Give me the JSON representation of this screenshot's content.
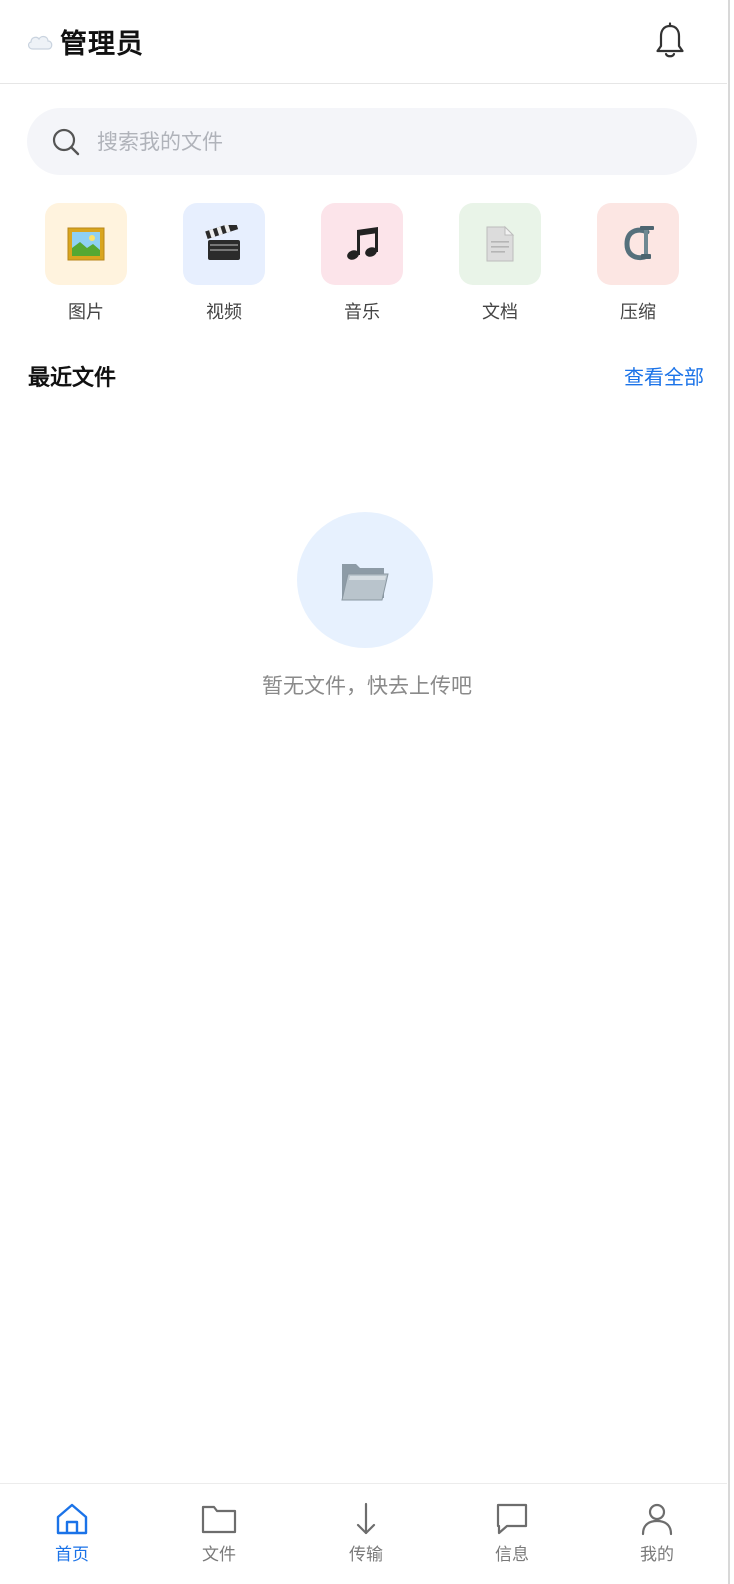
{
  "header": {
    "title": "管理员",
    "cloud_icon": "cloud-icon",
    "bell_icon": "bell-icon"
  },
  "search": {
    "placeholder": "搜索我的文件",
    "value": ""
  },
  "categories": [
    {
      "label": "图片",
      "icon": "picture-icon",
      "tile_color": "#fff3de"
    },
    {
      "label": "视频",
      "icon": "clapper-icon",
      "tile_color": "#e7effe"
    },
    {
      "label": "音乐",
      "icon": "music-note-icon",
      "tile_color": "#fce4ea"
    },
    {
      "label": "文档",
      "icon": "document-icon",
      "tile_color": "#e9f4e8"
    },
    {
      "label": "压缩",
      "icon": "clamp-icon",
      "tile_color": "#fce6e3"
    }
  ],
  "recent": {
    "title": "最近文件",
    "view_all": "查看全部",
    "empty_text": "暂无文件，快去上传吧",
    "empty_icon": "open-folder-icon"
  },
  "tabbar": {
    "tabs": [
      {
        "label": "首页",
        "icon": "home-icon",
        "active": true
      },
      {
        "label": "文件",
        "icon": "folder-icon",
        "active": false
      },
      {
        "label": "传输",
        "icon": "download-arrow-icon",
        "active": false
      },
      {
        "label": "信息",
        "icon": "message-icon",
        "active": false
      },
      {
        "label": "我的",
        "icon": "user-icon",
        "active": false
      }
    ]
  },
  "colors": {
    "accent": "#1b73e8",
    "text_primary": "#111111",
    "text_muted": "#8a8a8a"
  }
}
